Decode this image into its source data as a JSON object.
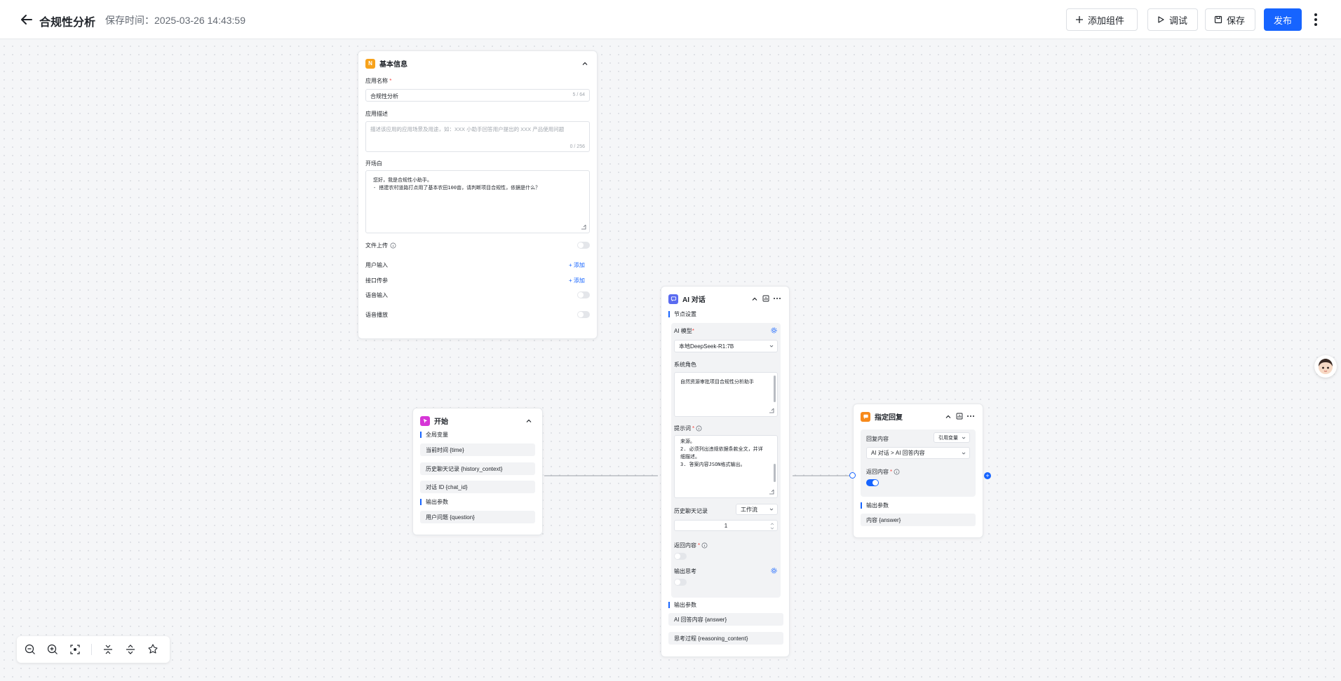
{
  "header": {
    "title": "合规性分析",
    "save_time": "保存时间：2025-03-26 14:43:59",
    "add_component": "添加组件",
    "debug": "调试",
    "save": "保存",
    "publish": "发布"
  },
  "basic_info": {
    "title": "基本信息",
    "badge": "N",
    "app_name_label": "应用名称",
    "app_name_value": "合规性分析",
    "app_name_count": "5 / 64",
    "app_desc_label": "应用描述",
    "app_desc_placeholder": "描述该应用的应用场景及用途，如：XXX 小助手回答用户提出的 XXX 产品使用问题",
    "app_desc_count": "0 / 256",
    "opening_label": "开场白",
    "opening_line1": "您好，我是合规性小助手。",
    "opening_line2": "- 搭建农村道路打点用了基本农田100亩，请判断项目合规性，依据是什么？",
    "file_upload": "文件上传",
    "user_input": "用户输入",
    "interface_params": "接口传参",
    "voice_input": "语音输入",
    "voice_play": "语音播放",
    "add": "+ 添加"
  },
  "start_node": {
    "title": "开始",
    "global_vars": "全局变量",
    "vars": [
      "当前时间 {time}",
      "历史聊天记录 {history_context}",
      "对话 ID {chat_id}"
    ],
    "output_params": "输出参数",
    "outputs": [
      "用户问题 {question}"
    ]
  },
  "ai_node": {
    "title": "AI 对话",
    "node_settings": "节点设置",
    "model_label": "AI 模型",
    "model_value": "本地DeepSeek-R1:7B",
    "system_role_label": "系统角色",
    "system_role_value": "自然资源审批项目合规性分析助手",
    "prompt_label": "提示词",
    "prompt_line1": "来源。",
    "prompt_line2": "2. 必须列出违规依据条款全文，并详细描述。",
    "prompt_line3": "3. 答案内容JSON格式输出。",
    "history_label": "历史聊天记录",
    "history_select": "工作流",
    "history_value": "1",
    "return_label": "返回内容",
    "output_think_label": "输出思考",
    "output_params": "输出参数",
    "outputs": [
      "AI 回答内容 {answer}",
      "思考过程 {reasoning_content}"
    ]
  },
  "reply_node": {
    "title": "指定回复",
    "reply_content_label": "回复内容",
    "reply_mode": "引用变量",
    "reply_value": "AI 对话 > AI 回答内容",
    "return_label": "返回内容",
    "output_params": "输出参数",
    "outputs": [
      "内容 {answer}"
    ]
  },
  "colors": {
    "primary": "#1664ff",
    "basic_badge": "#f7a21b",
    "start_badge": "#d636d6",
    "ai_badge": "#5a6bf0",
    "reply_badge": "#f78a1b"
  }
}
